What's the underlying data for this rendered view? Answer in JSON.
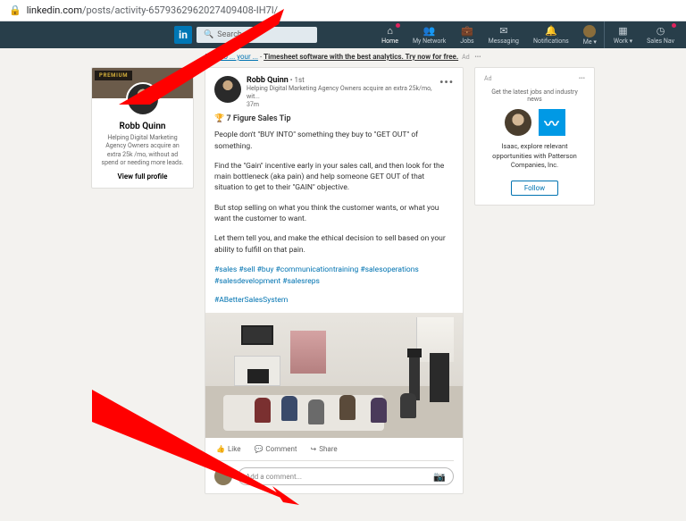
{
  "url_host": "linkedin.com",
  "url_path": "/posts/activity-6579362962027409408-IH7l/",
  "search_placeholder": "Search",
  "nav": {
    "home": "Home",
    "network": "My Network",
    "jobs": "Jobs",
    "messaging": "Messaging",
    "notifications": "Notifications",
    "me": "Me",
    "work": "Work",
    "sales": "Sales Nav"
  },
  "sponsored": {
    "lead": "KPIs to ... your ...",
    "text": "Timesheet software with the best analytics. Try now for free.",
    "ad": "Ad"
  },
  "profile": {
    "premium": "PREMIUM",
    "name": "Robb Quinn",
    "sub": "Helping Digital Marketing Agency Owners acquire an extra 25k /mo, without ad spend or needing more leads.",
    "view": "View full profile"
  },
  "post": {
    "author": "Robb Quinn",
    "degree": " • 1st",
    "headline": "Helping Digital Marketing Agency Owners acquire an extra 25k/mo, wit...",
    "time": "37m",
    "title": "🏆 7 Figure Sales Tip",
    "p1": "People don't \"BUY INTO\" something they buy to \"GET OUT\" of something.",
    "p2": "Find the \"Gain\" incentive early in your sales call, and then look for the main bottleneck (aka pain) and help someone GET OUT of that situation to get to their \"GAIN\" objective.",
    "p3": "But stop selling on what you think the customer wants, or what you want the customer to want.",
    "p4": "Let them tell you, and make the ethical decision to sell based on your ability to fulfill on that pain.",
    "tags1": "#sales #sell #buy #communicationtraining #salesoperations #salesdevelopment #salesreps",
    "tags2": "#ABetterSalesSystem",
    "like": "Like",
    "comment": "Comment",
    "share": "Share",
    "comment_placeholder": "Add a comment..."
  },
  "right": {
    "ad": "Ad",
    "menu": "•••",
    "sub": "Get the latest jobs and industry news",
    "text": "Isaac, explore relevant opportunities with Patterson Companies, Inc.",
    "follow": "Follow"
  }
}
